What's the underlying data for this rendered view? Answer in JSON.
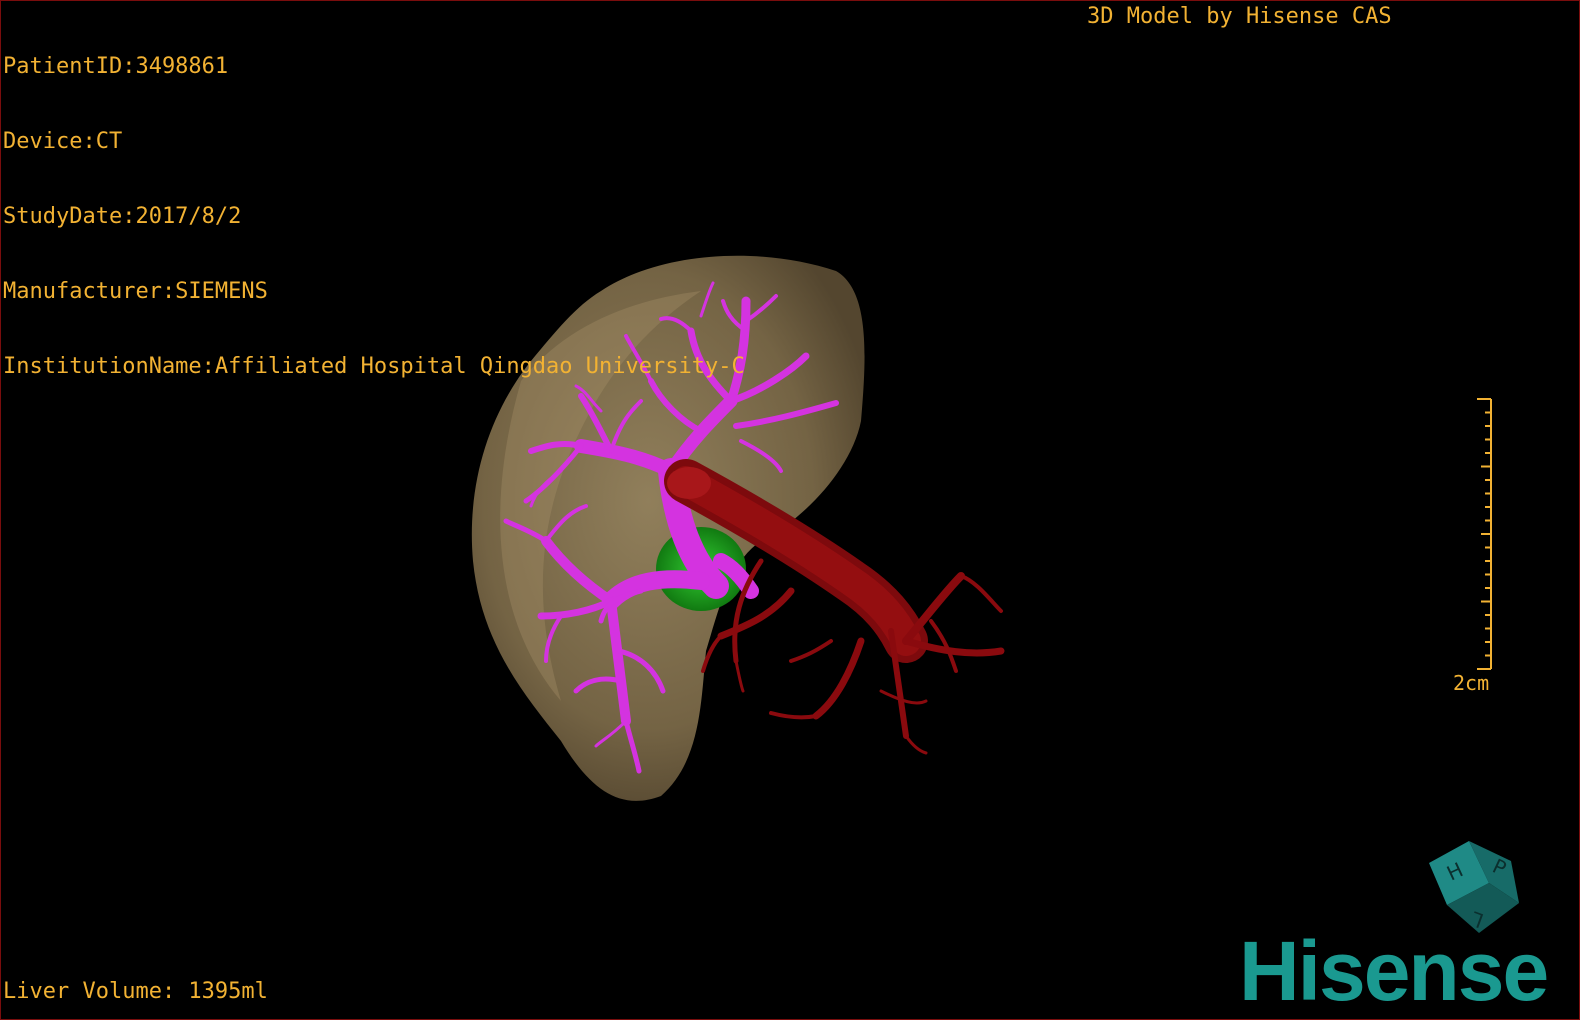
{
  "header": {
    "patient_id_label": "PatientID:3498861",
    "device_label": "Device:CT",
    "study_date_label": "StudyDate:2017/8/2",
    "manufacturer_label": "Manufacturer:SIEMENS",
    "institution_label": "InstitutionName:Affiliated Hospital Qingdao University-C"
  },
  "model_credit": "3D Model by Hisense CAS",
  "liver_volume": "Liver Volume: 1395ml",
  "scale": {
    "label": "2cm"
  },
  "orientation_cube": {
    "labels": [
      "H",
      "P",
      "L"
    ],
    "color": "#1f8a86"
  },
  "brand": {
    "name": "Hisense",
    "color": "#1a9990"
  },
  "colors": {
    "text": "#f2b233",
    "background": "#000000",
    "liver": "#8c7a56",
    "portal_vein": "#d433e0",
    "artery": "#8a0a0e",
    "tumor": "#1fa21f"
  },
  "icons": [
    "orientation-cube-icon",
    "hisense-logo"
  ]
}
